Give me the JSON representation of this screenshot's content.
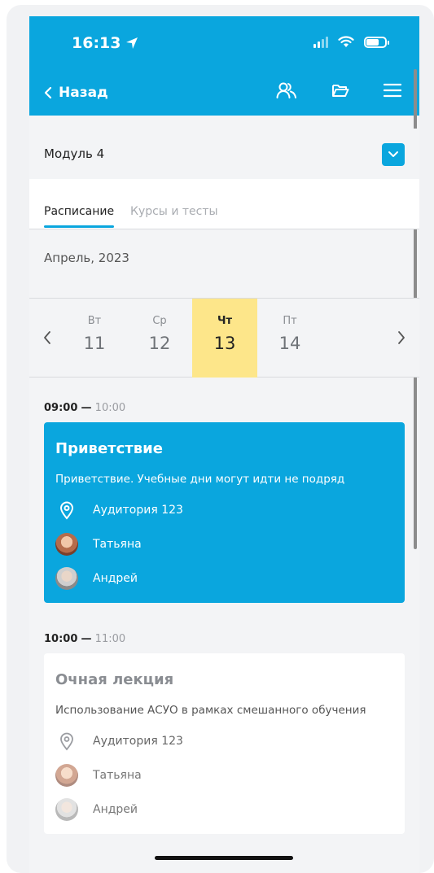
{
  "status": {
    "time": "16:13"
  },
  "nav": {
    "back_label": "Назад"
  },
  "module": {
    "label": "Модуль 4"
  },
  "tabs": [
    {
      "label": "Расписание",
      "active": true
    },
    {
      "label": "Курсы и тесты",
      "active": false
    }
  ],
  "month": "Апрель, 2023",
  "days": [
    {
      "name": "Вт",
      "date": "11",
      "selected": false
    },
    {
      "name": "Ср",
      "date": "12",
      "selected": false
    },
    {
      "name": "Чт",
      "date": "13",
      "selected": true
    },
    {
      "name": "Пт",
      "date": "14",
      "selected": false
    }
  ],
  "events": [
    {
      "start": "09:00",
      "end": "10:00",
      "title": "Приветствие",
      "description": "Приветствие. Учебные дни могут идти не подряд",
      "location": "Аудитория 123",
      "people": [
        "Татьяна",
        "Андрей"
      ]
    },
    {
      "start": "10:00",
      "end": "11:00",
      "title": "Очная лекция",
      "description": "Использование АСУО в рамках смешанного обучения",
      "location": "Аудитория 123",
      "people": [
        "Татьяна",
        "Андрей"
      ]
    }
  ],
  "colors": {
    "accent": "#0aa6de",
    "selected_day": "#fde68a"
  }
}
